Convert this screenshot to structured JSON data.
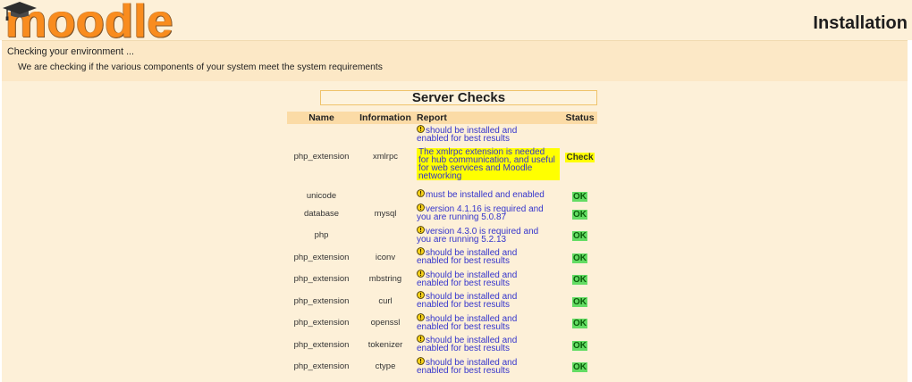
{
  "header": {
    "logo_text": "moodle",
    "logo_icon": "graduation-cap-icon",
    "title": "Installation"
  },
  "environment": {
    "heading": "Checking your environment ...",
    "description": "We are checking if the various components of your system meet the system requirements"
  },
  "server_checks": {
    "title": "Server Checks",
    "columns": {
      "name": "Name",
      "information": "Information",
      "report": "Report",
      "status": "Status"
    },
    "report_icon": "warning-icon",
    "rows": [
      {
        "name": "php_extension",
        "information": "xmlrpc",
        "report": [
          "should be installed and",
          "enabled for best results"
        ],
        "notice": [
          "The xmlrpc extension is needed",
          "for hub communication, and useful",
          "for web services and Moodle",
          "networking"
        ],
        "status": "Check",
        "status_background": "#ffff00",
        "status_text_color": "#3a3a20"
      },
      {
        "name": "unicode",
        "information": "",
        "report": [
          "must be installed and enabled"
        ],
        "status": "OK",
        "status_background": "#63dc63",
        "status_text_color": "#0b5d0b"
      },
      {
        "name": "database",
        "information": "mysql",
        "report": [
          "version 4.1.16 is required and",
          "you are running 5.0.87"
        ],
        "status": "OK",
        "status_background": "#63dc63",
        "status_text_color": "#0b5d0b"
      },
      {
        "name": "php",
        "information": "",
        "report": [
          "version 4.3.0 is required and",
          "you are running 5.2.13"
        ],
        "status": "OK",
        "status_background": "#63dc63",
        "status_text_color": "#0b5d0b"
      },
      {
        "name": "php_extension",
        "information": "iconv",
        "report": [
          "should be installed and",
          "enabled for best results"
        ],
        "status": "OK",
        "status_background": "#63dc63",
        "status_text_color": "#0b5d0b"
      },
      {
        "name": "php_extension",
        "information": "mbstring",
        "report": [
          "should be installed and",
          "enabled for best results"
        ],
        "status": "OK",
        "status_background": "#63dc63",
        "status_text_color": "#0b5d0b"
      },
      {
        "name": "php_extension",
        "information": "curl",
        "report": [
          "should be installed and",
          "enabled for best results"
        ],
        "status": "OK",
        "status_background": "#63dc63",
        "status_text_color": "#0b5d0b"
      },
      {
        "name": "php_extension",
        "information": "openssl",
        "report": [
          "should be installed and",
          "enabled for best results"
        ],
        "status": "OK",
        "status_background": "#63dc63",
        "status_text_color": "#0b5d0b"
      },
      {
        "name": "php_extension",
        "information": "tokenizer",
        "report": [
          "should be installed and",
          "enabled for best results"
        ],
        "status": "OK",
        "status_background": "#63dc63",
        "status_text_color": "#0b5d0b"
      },
      {
        "name": "php_extension",
        "information": "ctype",
        "report": [
          "should be installed and",
          "enabled for best results"
        ],
        "status": "OK",
        "status_background": "#63dc63",
        "status_text_color": "#0b5d0b"
      }
    ]
  },
  "colors": {
    "page_background": "#fdf0d8",
    "band_background": "#fce8c6",
    "table_header_background": "#fbdba6",
    "report_text": "#3434cc",
    "notice_background": "#ffff00",
    "logo_orange": "#f98c1e"
  }
}
